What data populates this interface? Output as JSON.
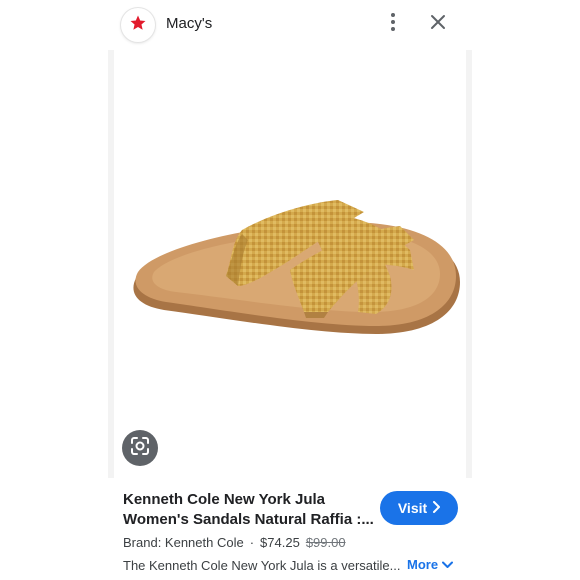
{
  "header": {
    "site_name": "Macy's",
    "logo_icon": "star-icon",
    "logo_color": "#e21a2c"
  },
  "image": {
    "subject": "sandal-image",
    "lens_icon": "google-lens-icon"
  },
  "product": {
    "title_line1": "Kenneth Cole New York Jula",
    "title_line2": "Women's Sandals Natural Raffia :...",
    "brand_label": "Brand: Kenneth Cole",
    "separator": "·",
    "price": "$74.25",
    "original_price": "$99.00",
    "description": "The Kenneth Cole New York Jula is a versatile...",
    "visit_label": "Visit",
    "more_label": "More"
  },
  "colors": {
    "accent": "#1a73e8",
    "brand": "#e21a2c"
  }
}
